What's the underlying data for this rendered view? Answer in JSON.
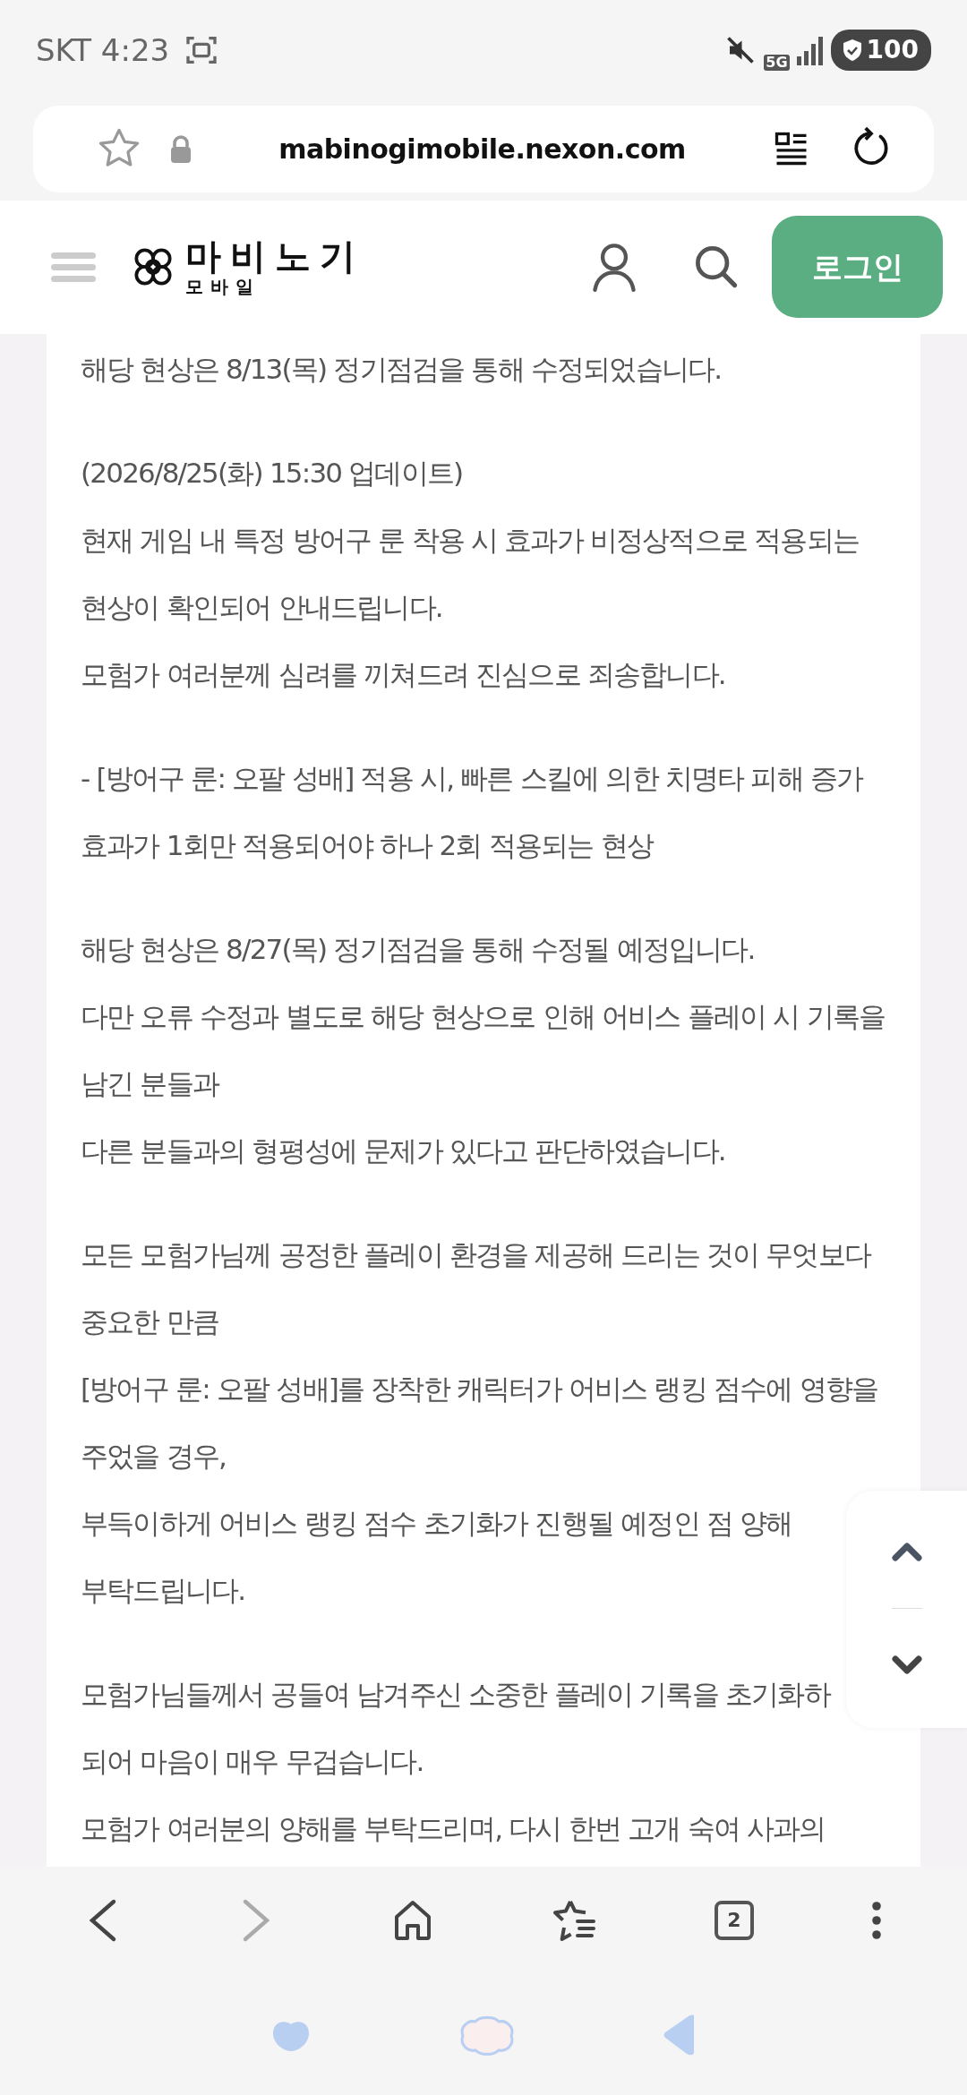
{
  "status_bar": {
    "carrier_time": "SKT 4:23",
    "network": "5G",
    "battery": "100"
  },
  "address_bar": {
    "url": "mabinogimobile.nexon.com"
  },
  "site_header": {
    "logo_title": "마비노기",
    "logo_subtitle": "모바일",
    "login_button": "로그인"
  },
  "article": {
    "paragraphs": [
      [
        "해당 현상은 8/13(목) 정기점검을 통해 수정되었습니다."
      ],
      [
        "(2026/8/25(화) 15:30 업데이트)",
        "현재 게임 내 특정 방어구 룬 착용 시 효과가 비정상적으로 적용되는",
        "현상이 확인되어 안내드립니다.",
        "모험가 여러분께 심려를 끼쳐드려 진심으로 죄송합니다."
      ],
      [
        "- [방어구 룬: 오팔 성배] 적용 시, 빠른 스킬에 의한 치명타 피해 증가",
        "효과가 1회만 적용되어야 하나 2회 적용되는 현상"
      ],
      [
        "해당 현상은 8/27(목) 정기점검을 통해 수정될 예정입니다.",
        "다만 오류 수정과 별도로 해당 현상으로 인해 어비스 플레이 시 기록을",
        "남긴 분들과",
        "다른 분들과의 형평성에 문제가 있다고 판단하였습니다."
      ],
      [
        "모든 모험가님께 공정한 플레이 환경을 제공해 드리는 것이 무엇보다",
        "중요한 만큼",
        "[방어구 룬: 오팔 성배]를 장착한 캐릭터가 어비스 랭킹 점수에 영향을",
        "주었을 경우,",
        "부득이하게 어비스 랭킹 점수 초기화가 진행될 예정인 점 양해",
        "부탁드립니다."
      ],
      [
        "모험가님들께서 공들여 남겨주신 소중한 플레이 기록을 초기화하",
        "되어 마음이 매우 무겁습니다.",
        "모험가 여러분의 양해를 부탁드리며, 다시 한번 고개 숙여 사과의"
      ]
    ]
  },
  "browser_toolbar": {
    "tab_count": "2",
    "forward_disabled": true
  }
}
